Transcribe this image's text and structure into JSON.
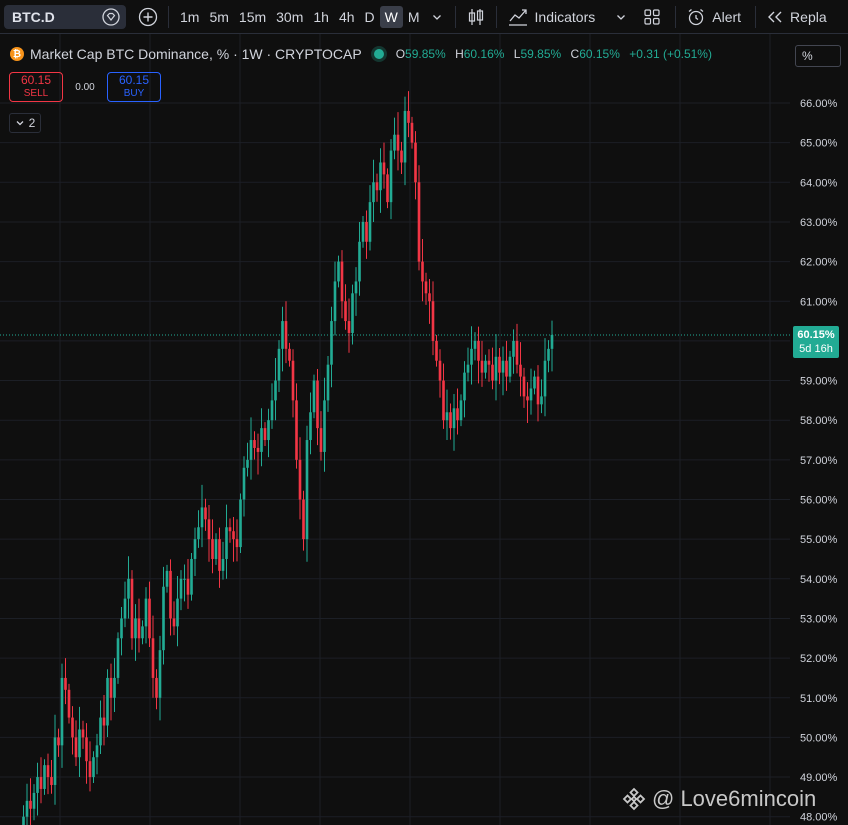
{
  "toolbar": {
    "symbol": "BTC.D",
    "timeframes": [
      "1m",
      "5m",
      "15m",
      "30m",
      "1h",
      "4h",
      "D",
      "W",
      "M"
    ],
    "active_timeframe": "W",
    "indicators_label": "Indicators",
    "alert_label": "Alert",
    "replay_label": "Repla"
  },
  "legend": {
    "title": "Market Cap BTC Dominance, % · 1W · CRYPTOCAP",
    "btc_symbol": "₿",
    "open_label": "O",
    "open_value": "59.85%",
    "high_label": "H",
    "high_value": "60.16%",
    "low_label": "L",
    "low_value": "59.85%",
    "close_label": "C",
    "close_value": "60.15%",
    "change": "+0.31 (+0.51%)"
  },
  "trade": {
    "sell_price": "60.15",
    "sell_label": "SELL",
    "spread": "0.00",
    "buy_price": "60.15",
    "buy_label": "BUY"
  },
  "indicators_collapse_count": "2",
  "scale_mode": "%",
  "last_price": {
    "value": "60.15%",
    "countdown": "5d 16h",
    "color": "#22ab94"
  },
  "colors": {
    "up": "#22ab94",
    "down": "#f23645",
    "background": "#0f0f0f",
    "grid": "#1c1f26"
  },
  "watermark": "@ Love6mincoin",
  "chart_data": {
    "type": "candlestick",
    "title": "Market Cap BTC Dominance, % · 1W · CRYPTOCAP",
    "yticks": [
      "66.00%",
      "65.00%",
      "64.00%",
      "63.00%",
      "62.00%",
      "61.00%",
      "60.00%",
      "59.00%",
      "58.00%",
      "57.00%",
      "56.00%",
      "55.00%",
      "54.00%",
      "53.00%",
      "52.00%",
      "51.00%",
      "50.00%",
      "49.00%",
      "48.00%"
    ],
    "ylim": [
      47.95,
      66.7
    ],
    "last_value": 60.15,
    "close": [
      47.6,
      48.0,
      48.4,
      48.2,
      48.6,
      49.0,
      48.7,
      49.3,
      49.0,
      48.8,
      50.0,
      49.8,
      51.5,
      51.2,
      50.5,
      50.0,
      49.5,
      50.2,
      50.0,
      49.4,
      49.0,
      49.5,
      49.8,
      50.5,
      50.3,
      51.5,
      51.0,
      51.5,
      52.5,
      53.0,
      53.5,
      54.0,
      52.5,
      53.0,
      52.5,
      52.8,
      53.5,
      52.5,
      51.5,
      51.0,
      52.2,
      53.8,
      54.2,
      53.0,
      52.8,
      53.5,
      54.0,
      54.0,
      53.6,
      54.5,
      55.0,
      55.3,
      55.8,
      55.5,
      55.0,
      54.5,
      55.0,
      54.2,
      54.5,
      55.3,
      55.2,
      55.0,
      54.8,
      56.0,
      56.8,
      57.0,
      57.5,
      57.3,
      57.2,
      57.8,
      57.5,
      58.0,
      58.5,
      59.0,
      59.8,
      60.5,
      59.8,
      59.5,
      58.5,
      57.0,
      56.0,
      55.0,
      57.5,
      58.2,
      59.0,
      57.8,
      57.2,
      58.5,
      59.4,
      60.5,
      61.5,
      62.0,
      61.0,
      60.5,
      60.2,
      61.2,
      61.5,
      62.5,
      63.0,
      62.5,
      63.5,
      64.0,
      63.8,
      64.5,
      64.2,
      63.5,
      64.8,
      65.2,
      64.8,
      64.5,
      65.8,
      65.5,
      65.0,
      64.0,
      62.0,
      61.5,
      61.2,
      61.0,
      60.0,
      59.5,
      59.0,
      58.0,
      58.2,
      57.8,
      58.3,
      58.0,
      58.5,
      59.2,
      59.4,
      59.8,
      60.0,
      59.5,
      59.2,
      59.5,
      59.4,
      59.0,
      59.6,
      59.2,
      59.5,
      59.1,
      59.6,
      60.0,
      59.4,
      59.1,
      58.6,
      58.5,
      58.8,
      59.1,
      58.4,
      58.6,
      59.5,
      59.8,
      60.15
    ]
  }
}
